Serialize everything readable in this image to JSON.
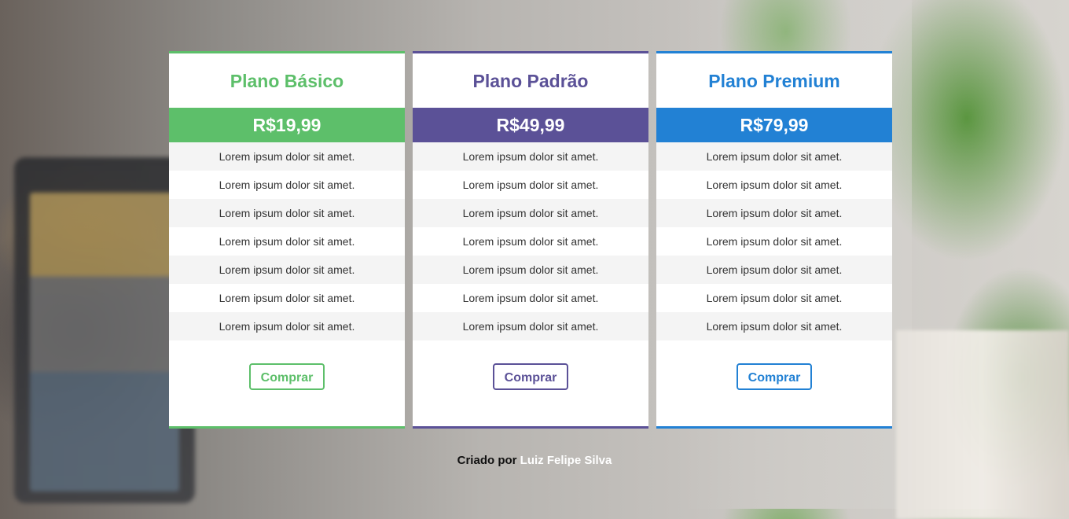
{
  "plans": [
    {
      "title": "Plano Básico",
      "price": "R$19,99",
      "color": "#5dbf6a",
      "features": [
        "Lorem ipsum dolor sit amet.",
        "Lorem ipsum dolor sit amet.",
        "Lorem ipsum dolor sit amet.",
        "Lorem ipsum dolor sit amet.",
        "Lorem ipsum dolor sit amet.",
        "Lorem ipsum dolor sit amet.",
        "Lorem ipsum dolor sit amet."
      ],
      "button_label": "Comprar"
    },
    {
      "title": "Plano Padrão",
      "price": "R$49,99",
      "color": "#5b5197",
      "features": [
        "Lorem ipsum dolor sit amet.",
        "Lorem ipsum dolor sit amet.",
        "Lorem ipsum dolor sit amet.",
        "Lorem ipsum dolor sit amet.",
        "Lorem ipsum dolor sit amet.",
        "Lorem ipsum dolor sit amet.",
        "Lorem ipsum dolor sit amet."
      ],
      "button_label": "Comprar"
    },
    {
      "title": "Plano Premium",
      "price": "R$79,99",
      "color": "#2281d4",
      "features": [
        "Lorem ipsum dolor sit amet.",
        "Lorem ipsum dolor sit amet.",
        "Lorem ipsum dolor sit amet.",
        "Lorem ipsum dolor sit amet.",
        "Lorem ipsum dolor sit amet.",
        "Lorem ipsum dolor sit amet.",
        "Lorem ipsum dolor sit amet."
      ],
      "button_label": "Comprar"
    }
  ],
  "footer": {
    "prefix": "Criado por",
    "author": "Luiz Felipe Silva"
  }
}
